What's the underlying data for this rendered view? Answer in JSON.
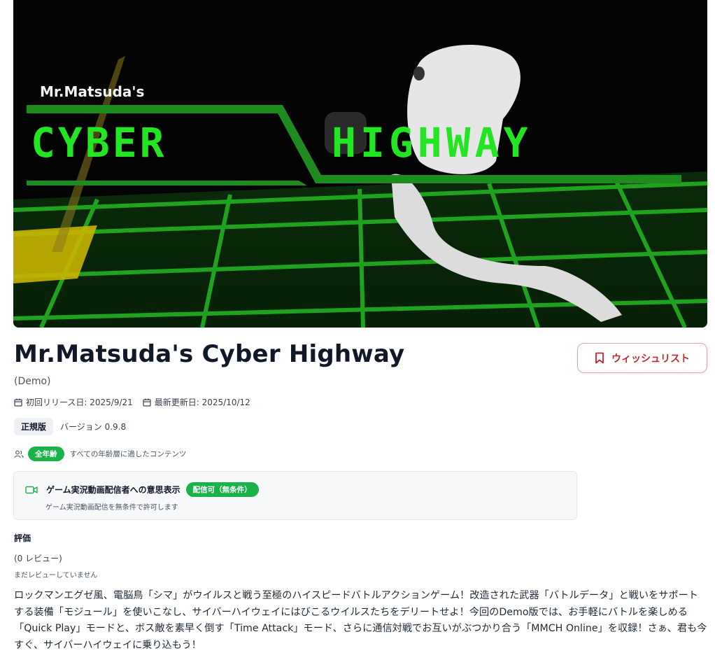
{
  "hero": {
    "subtitle_logo": "Mr.Matsuda's",
    "logo_left": "CYBER",
    "logo_right": "HIGHWAY"
  },
  "game": {
    "title": "Mr.Matsuda's Cyber Highway",
    "edition": "(Demo)",
    "first_release": "初回リリース日: 2025/9/21",
    "last_update": "最新更新日: 2025/10/12",
    "release_type": "正規版",
    "version": "バージョン 0.9.8"
  },
  "wishlist": {
    "label": "ウィッシュリスト"
  },
  "age": {
    "badge": "全年齢",
    "note": "すべての年齢層に適したコンテンツ"
  },
  "streaming": {
    "label": "ゲーム実況動画配信者への意思表示",
    "status": "配信可（無条件）",
    "note": "ゲーム実況動画配信を無条件で許可します"
  },
  "rating": {
    "heading": "評価",
    "count": "(0 レビュー)",
    "note": "まだレビューしていません"
  },
  "description": "ロックマンエグゼ風、電脳鳥「シマ」がウイルスと戦う至極のハイスピードバトルアクションゲーム！改造された武器「バトルデータ」と戦いをサポートする装備「モジュール」を使いこなし、サイバーハイウェイにはびこるウイルスたちをデリートせよ！今回のDemo版では、お手軽にバトルを楽しめる「Quick Play」モードと、ボス敵を素早く倒す「Time Attack」モード、さらに通信対戦でお互いがぶつかり合う「MMCH Online」を収録！さぁ、君も今すぐ、サイバーハイウェイに乗り込もう！",
  "colors": {
    "accent_red": "#c0262d",
    "badge_green": "#19b34a",
    "logo_green": "#22e622"
  },
  "icons": [
    "calendar-icon",
    "users-icon",
    "video-icon",
    "bookmark-icon"
  ]
}
